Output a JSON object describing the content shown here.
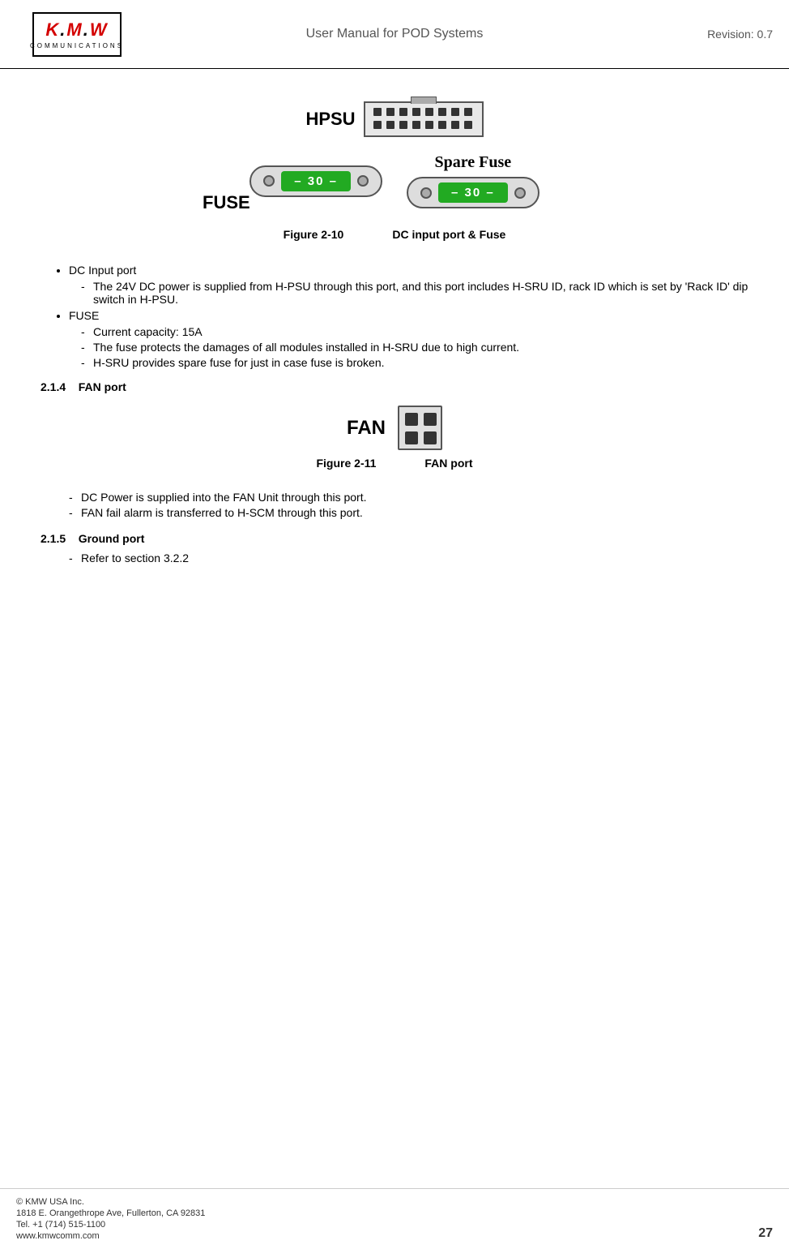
{
  "header": {
    "title": "User Manual for POD Systems",
    "revision": "Revision: 0.7",
    "logo_kmw": "K.M.W",
    "logo_sub": "COMMUNICATIONS"
  },
  "figures": {
    "fig210": {
      "label": "Figure 2-10",
      "title": "DC input port & Fuse",
      "hpsu_label": "HPSU",
      "fuse_label": "FUSE",
      "spare_fuse_label": "Spare Fuse",
      "fuse_value": "– 30 –"
    },
    "fig211": {
      "label": "Figure 2-11",
      "title": "FAN port",
      "fan_label": "FAN"
    }
  },
  "sections": {
    "dc_input": {
      "bullet": "DC Input port",
      "sub1": "The 24V DC power is supplied from H-PSU through this port, and this port includes H-SRU ID, rack ID which is set by 'Rack ID' dip switch in H-PSU."
    },
    "fuse": {
      "bullet": "FUSE",
      "sub1": "Current capacity: 15A",
      "sub2": "The fuse protects the damages of all modules installed in H-SRU due to high current.",
      "sub3": "H-SRU provides spare fuse for just in case fuse is broken."
    },
    "section_214": {
      "number": "2.1.4",
      "title": "FAN port",
      "sub1": "DC Power is supplied into the FAN Unit through this port.",
      "sub2": "FAN fail alarm is transferred to H-SCM through this port."
    },
    "section_215": {
      "number": "2.1.5",
      "title": "Ground port",
      "sub1": "Refer to section 3.2.2"
    }
  },
  "footer": {
    "company": "© KMW USA Inc.",
    "address": "1818 E. Orangethrope Ave, Fullerton, CA 92831",
    "tel": "Tel. +1 (714) 515-1100",
    "web": "www.kmwcomm.com",
    "page": "27"
  }
}
